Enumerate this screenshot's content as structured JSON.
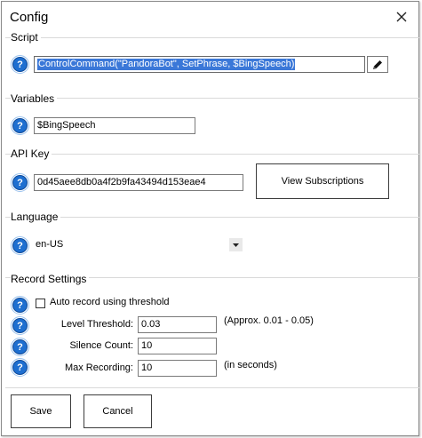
{
  "dialog": {
    "title": "Config"
  },
  "icons": {
    "help": "question-circle-icon",
    "close": "close-x-icon",
    "edit": "pencil-icon",
    "dropdown": "chevron-down-icon"
  },
  "colors": {
    "help_blue": "#1e6fd0",
    "selection_blue": "#3b78d8"
  },
  "script": {
    "section_title": "Script",
    "value": "ControlCommand(\"PandoraBot\", SetPhrase, $BingSpeech)"
  },
  "variables": {
    "section_title": "Variables",
    "value": "$BingSpeech"
  },
  "api_key": {
    "section_title": "API Key",
    "value": "0d45aee8db0a4f2b9fa43494d153eae4",
    "view_subscriptions_label": "View Subscriptions"
  },
  "language": {
    "section_title": "Language",
    "selected": "en-US"
  },
  "record_settings": {
    "section_title": "Record Settings",
    "auto_record_label": "Auto record using threshold",
    "auto_record_checked": false,
    "level_threshold_label": "Level Threshold:",
    "level_threshold_value": "0.03",
    "level_threshold_hint": "(Approx. 0.01 - 0.05)",
    "silence_count_label": "Silence Count:",
    "silence_count_value": "10",
    "max_recording_label": "Max Recording:",
    "max_recording_value": "10",
    "max_recording_hint": "(in seconds)"
  },
  "footer": {
    "save_label": "Save",
    "cancel_label": "Cancel"
  }
}
